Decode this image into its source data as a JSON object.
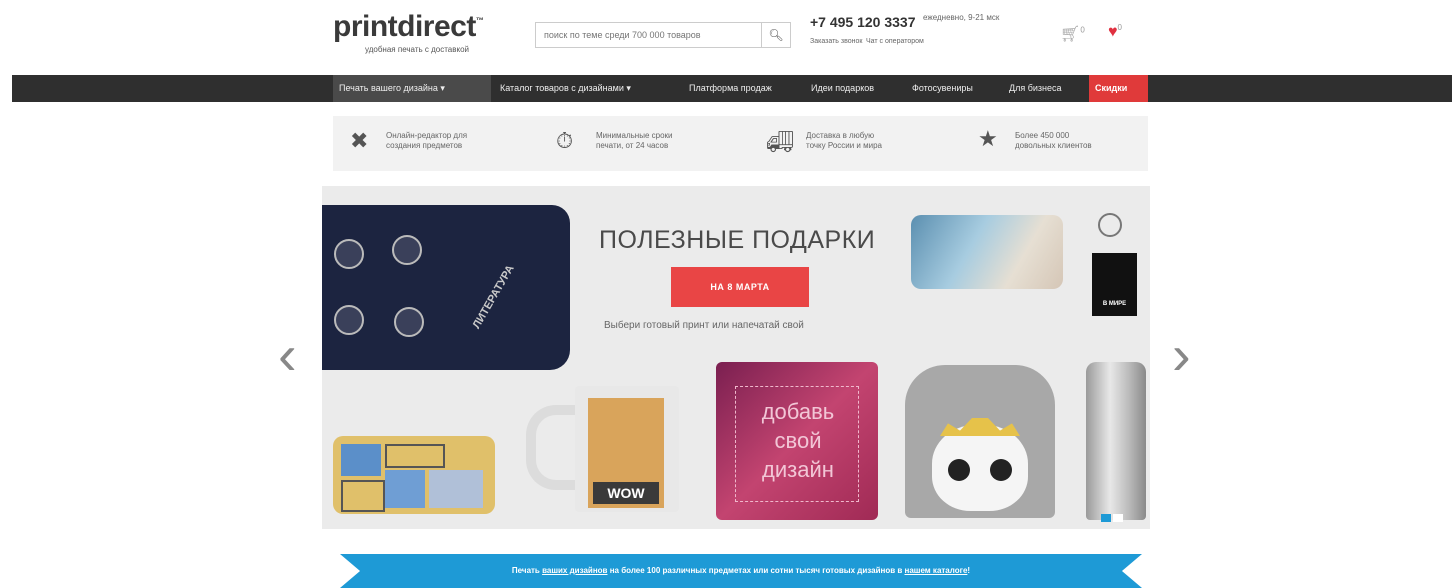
{
  "header": {
    "logo": "printdirect",
    "logo_tm": "™",
    "tagline": "удобная печать с доставкой",
    "search_placeholder": "поиск по теме среди 700 000 товаров",
    "phone": "+7 495 120 3337",
    "hours": "ежедневно, 9-21 мск",
    "callback": "Заказать звонок",
    "chat": "Чат с оператором",
    "cart_count": "0",
    "wishlist_count": "0"
  },
  "nav": {
    "items": [
      {
        "label": "Печать вашего дизайна ▾"
      },
      {
        "label": "Каталог товаров с дизайнами ▾"
      },
      {
        "label": "Платформа продаж"
      },
      {
        "label": "Идеи подарков"
      },
      {
        "label": "Фотосувениры"
      },
      {
        "label": "Для бизнеса"
      },
      {
        "label": "Скидки"
      }
    ]
  },
  "features": [
    {
      "icon": "pencil-ruler-icon",
      "line1": "Онлайн-редактор для",
      "line2": "создания предметов"
    },
    {
      "icon": "stopwatch-icon",
      "line1": "Минимальные сроки",
      "line2": "печати, от 24 часов"
    },
    {
      "icon": "truck-icon",
      "line1": "Доставка в любую",
      "line2": "точку России и мира"
    },
    {
      "icon": "star-icon",
      "line1": "Более 450 000",
      "line2": "довольных клиентов"
    }
  ],
  "banner": {
    "title": "ПОЛЕЗНЫЕ ПОДАРКИ",
    "button": "НА 8 МАРТА",
    "subtitle": "Выбери готовый принт или напечатай свой",
    "tshirt_print": "ЛИТЕРАТУРА",
    "mug_print": "WOW",
    "pillow_text_1": "добавь",
    "pillow_text_2": "свой",
    "pillow_text_3": "дизайн",
    "keychain_text": "В МИРЕ"
  },
  "ribbon": {
    "part1": "Печать ",
    "link1": "ваших дизайнов",
    "part2": " на более 100 различных предметах или сотни тысяч готовых дизайнов в ",
    "link2": "нашем каталоге",
    "part3": "!"
  },
  "colors": {
    "accent_red": "#e94545",
    "nav_bg": "#2f2f2f",
    "ribbon_blue": "#1e9ad6"
  }
}
